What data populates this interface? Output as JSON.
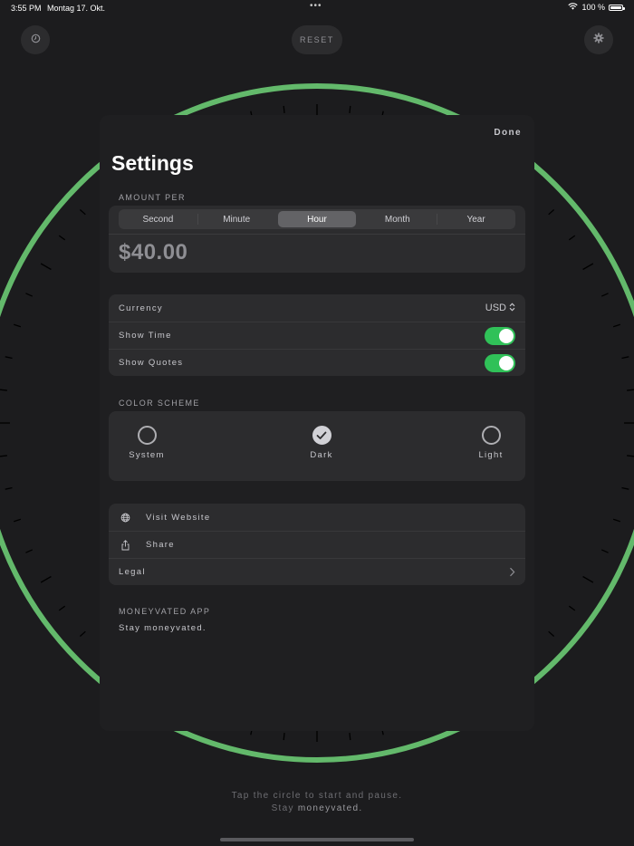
{
  "status_bar": {
    "time": "3:55 PM",
    "date": "Montag 17. Okt.",
    "battery": "100 %",
    "multitask_dots": "•••"
  },
  "toolbar": {
    "history_icon": "clock-icon",
    "reset_label": "RESET",
    "settings_icon": "gear-icon"
  },
  "colors": {
    "accent_green": "#63b96b",
    "toggle_on": "#30c158",
    "background": "#1c1c1e",
    "card": "#2c2c2e"
  },
  "footer": {
    "line1": "Tap the circle to start and pause.",
    "line2_prefix": "Stay",
    "line2_emph": "moneyvated."
  },
  "settings": {
    "done_label": "Done",
    "title": "Settings",
    "amount_per": {
      "section_label": "AMOUNT PER",
      "options": [
        "Second",
        "Minute",
        "Hour",
        "Month",
        "Year"
      ],
      "selected": "Hour",
      "amount": "$40.00"
    },
    "preferences": {
      "currency_label": "Currency",
      "currency_value": "USD",
      "show_time_label": "Show Time",
      "show_time_on": true,
      "show_quotes_label": "Show Quotes",
      "show_quotes_on": true
    },
    "color_scheme": {
      "section_label": "COLOR SCHEME",
      "options": [
        "System",
        "Dark",
        "Light"
      ],
      "selected": "Dark"
    },
    "links": {
      "website_label": "Visit Website",
      "share_label": "Share",
      "legal_label": "Legal"
    },
    "about": {
      "app_name": "MONEYVATED APP",
      "tagline": "Stay moneyvated."
    }
  }
}
